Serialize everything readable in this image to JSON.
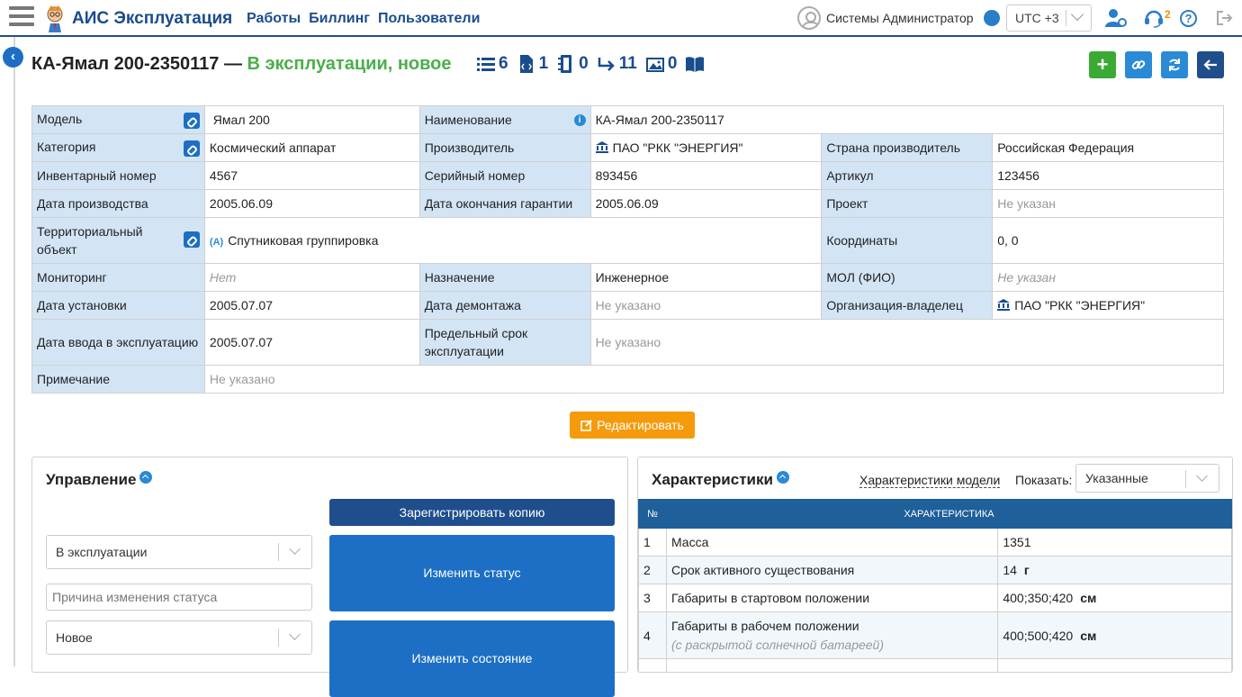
{
  "app": {
    "title": "АИС Эксплуатация"
  },
  "nav": [
    "Работы",
    "Биллинг",
    "Пользователи"
  ],
  "user": {
    "name": "Системы Администратор"
  },
  "timezone": {
    "value": "UTC +3"
  },
  "support_badge": "2",
  "help_label": "?",
  "page": {
    "title": "КА-Ямал 200-2350117 —",
    "status": "В эксплуатации, новое",
    "counters": [
      {
        "icon": "list-icon",
        "value": "6"
      },
      {
        "icon": "code-file-icon",
        "value": "1"
      },
      {
        "icon": "memory-chip-icon",
        "value": "0"
      },
      {
        "icon": "arrow-right-icon",
        "value": "11"
      },
      {
        "icon": "photo-icon",
        "value": "0"
      },
      {
        "icon": "book-icon",
        "value": ""
      }
    ]
  },
  "actions": {
    "add": "+",
    "link": "link",
    "refresh": "refresh",
    "back": "back"
  },
  "properties": {
    "model_label": "Модель",
    "model_value": "Ямал 200",
    "name_label": "Наименование",
    "name_value": "КА-Ямал 200-2350117",
    "category_label": "Категория",
    "category_value": "Космический аппарат",
    "manufacturer_label": "Производитель",
    "manufacturer_value": "ПАО \"РКК \"ЭНЕРГИЯ\"",
    "country_label": "Страна производитель",
    "country_value": "Российская Федерация",
    "inventory_label": "Инвентарный номер",
    "inventory_value": "4567",
    "serial_label": "Серийный номер",
    "serial_value": "893456",
    "article_label": "Артикул",
    "article_value": "123456",
    "prod_date_label": "Дата производства",
    "prod_date_value": "2005.06.09",
    "warranty_label": "Дата окончания гарантии",
    "warranty_value": "2005.06.09",
    "project_label": "Проект",
    "project_value": "Не указан",
    "territorial_label": "Территориальный объект",
    "territorial_value": "Спутниковая группировка",
    "coords_label": "Координаты",
    "coords_value": "0, 0",
    "monitoring_label": "Мониторинг",
    "monitoring_value": "Нет",
    "purpose_label": "Назначение",
    "purpose_value": "Инженерное",
    "mol_label": "МОЛ (ФИО)",
    "mol_value": "Не указан",
    "install_label": "Дата установки",
    "install_value": "2005.07.07",
    "dismount_label": "Дата демонтажа",
    "dismount_value": "Не указано",
    "owner_label": "Организация-владелец",
    "owner_value": "ПАО \"РКК \"ЭНЕРГИЯ\"",
    "commission_label": "Дата ввода в эксплуатацию",
    "commission_value": "2005.07.07",
    "lifetime_label": "Предельный срок эксплуатации",
    "lifetime_value": "Не указано",
    "note_label": "Примечание",
    "note_value": "Не указано"
  },
  "edit_button": "Редактировать",
  "management": {
    "title": "Управление",
    "register_copy": "Зарегистрировать копию",
    "status_select": "В эксплуатации",
    "change_status": "Изменить статус",
    "reason_placeholder": "Причина изменения статуса",
    "state_select": "Новое",
    "change_state": "Изменить состояние"
  },
  "characteristics": {
    "title": "Характеристики",
    "model_link": "Характеристики модели",
    "show_label": "Показать:",
    "show_value": "Указанные",
    "headers": [
      "№",
      "ХАРАКТЕРИСТИКА"
    ],
    "rows": [
      {
        "n": "1",
        "name": "Масса",
        "sub": "",
        "value": "1351",
        "unit": ""
      },
      {
        "n": "2",
        "name": "Срок активного существования",
        "sub": "",
        "value": "14",
        "unit": "г"
      },
      {
        "n": "3",
        "name": "Габариты в стартовом положении",
        "sub": "",
        "value": "400;350;420",
        "unit": "см"
      },
      {
        "n": "4",
        "name": "Габариты в рабочем положении",
        "sub": "(с раскрытой солнечной батареей)",
        "value": "400;500;420",
        "unit": "см"
      }
    ]
  },
  "colors": {
    "brand": "#1a4c8e",
    "status": "#4cae4c",
    "accent": "#f59a0b",
    "primary": "#1c6fc4",
    "label_bg": "#d3e5f5"
  }
}
